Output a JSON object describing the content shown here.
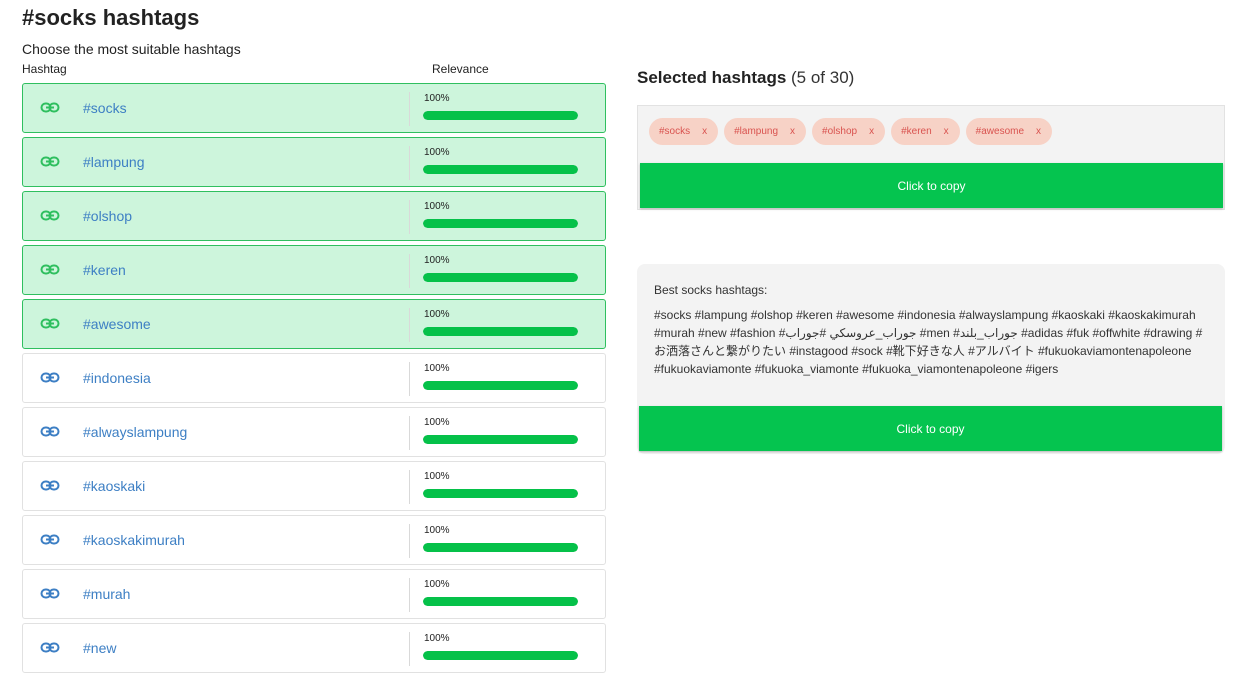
{
  "header": {
    "title": "#socks hashtags",
    "subtitle": "Choose the most suitable hashtags",
    "col_hashtag": "Hashtag",
    "col_relevance": "Relevance"
  },
  "colors": {
    "selected_row_bg": "#cdf5dc",
    "selected_row_border": "#2fbf5f",
    "bar_fill": "#05c149",
    "link_color": "#3d7fc4",
    "chip_bg": "#f7d2c6",
    "chip_text": "#d9534f",
    "copy_button": "#05c44f"
  },
  "hashtags": [
    {
      "tag": "#socks",
      "relevance": "100%",
      "fraction": 1.0,
      "selected": true
    },
    {
      "tag": "#lampung",
      "relevance": "100%",
      "fraction": 1.0,
      "selected": true
    },
    {
      "tag": "#olshop",
      "relevance": "100%",
      "fraction": 1.0,
      "selected": true
    },
    {
      "tag": "#keren",
      "relevance": "100%",
      "fraction": 1.0,
      "selected": true
    },
    {
      "tag": "#awesome",
      "relevance": "100%",
      "fraction": 1.0,
      "selected": true
    },
    {
      "tag": "#indonesia",
      "relevance": "100%",
      "fraction": 1.0,
      "selected": false
    },
    {
      "tag": "#alwayslampung",
      "relevance": "100%",
      "fraction": 1.0,
      "selected": false
    },
    {
      "tag": "#kaoskaki",
      "relevance": "100%",
      "fraction": 1.0,
      "selected": false
    },
    {
      "tag": "#kaoskakimurah",
      "relevance": "100%",
      "fraction": 1.0,
      "selected": false
    },
    {
      "tag": "#murah",
      "relevance": "100%",
      "fraction": 1.0,
      "selected": false
    },
    {
      "tag": "#new",
      "relevance": "100%",
      "fraction": 1.0,
      "selected": false
    }
  ],
  "selected": {
    "title": "Selected hashtags",
    "count": "(5 of 30)",
    "chips": [
      {
        "label": "#socks",
        "remove": "x"
      },
      {
        "label": "#lampung",
        "remove": "x"
      },
      {
        "label": "#olshop",
        "remove": "x"
      },
      {
        "label": "#keren",
        "remove": "x"
      },
      {
        "label": "#awesome",
        "remove": "x"
      }
    ],
    "copy_label": "Click to copy"
  },
  "best": {
    "title": "Best socks hashtags:",
    "text": "#socks #lampung #olshop #keren #awesome #indonesia #alwayslampung #kaoskaki #kaoskakimurah #murah #new #fashion #جوراب_عروسكي #جوراب #men #جوراب_بلند #adidas #fuk #offwhite #drawing #お洒落さんと繋がりたい #instagood #sock #靴下好きな人 #アルバイト #fukuokaviamontenapoleone #fukuokaviamonte #fukuoka_viamonte #fukuoka_viamontenapoleone #igers",
    "copy_label": "Click to copy"
  },
  "icons": {
    "row_icon": "link-icon"
  }
}
